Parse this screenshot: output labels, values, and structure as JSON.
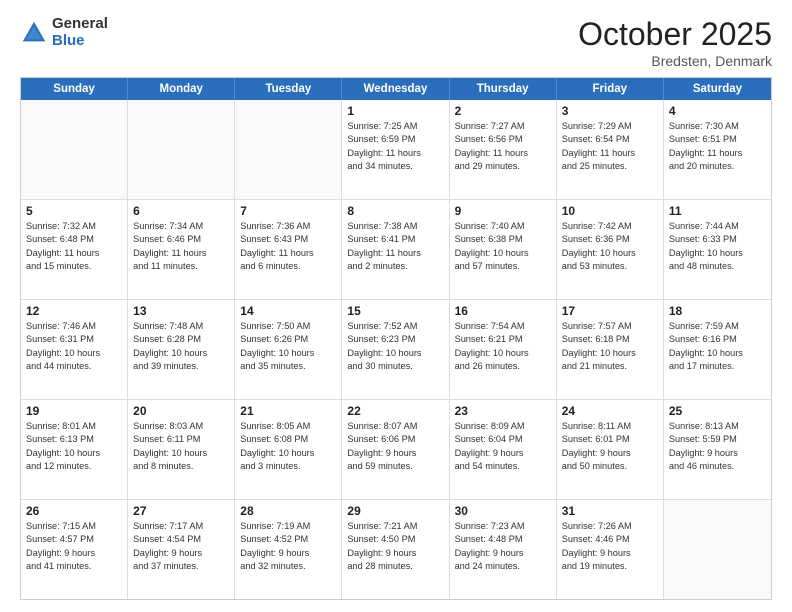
{
  "header": {
    "logo_general": "General",
    "logo_blue": "Blue",
    "month_title": "October 2025",
    "subtitle": "Bredsten, Denmark"
  },
  "days_of_week": [
    "Sunday",
    "Monday",
    "Tuesday",
    "Wednesday",
    "Thursday",
    "Friday",
    "Saturday"
  ],
  "weeks": [
    [
      {
        "day": "",
        "lines": []
      },
      {
        "day": "",
        "lines": []
      },
      {
        "day": "",
        "lines": []
      },
      {
        "day": "1",
        "lines": [
          "Sunrise: 7:25 AM",
          "Sunset: 6:59 PM",
          "Daylight: 11 hours",
          "and 34 minutes."
        ]
      },
      {
        "day": "2",
        "lines": [
          "Sunrise: 7:27 AM",
          "Sunset: 6:56 PM",
          "Daylight: 11 hours",
          "and 29 minutes."
        ]
      },
      {
        "day": "3",
        "lines": [
          "Sunrise: 7:29 AM",
          "Sunset: 6:54 PM",
          "Daylight: 11 hours",
          "and 25 minutes."
        ]
      },
      {
        "day": "4",
        "lines": [
          "Sunrise: 7:30 AM",
          "Sunset: 6:51 PM",
          "Daylight: 11 hours",
          "and 20 minutes."
        ]
      }
    ],
    [
      {
        "day": "5",
        "lines": [
          "Sunrise: 7:32 AM",
          "Sunset: 6:48 PM",
          "Daylight: 11 hours",
          "and 15 minutes."
        ]
      },
      {
        "day": "6",
        "lines": [
          "Sunrise: 7:34 AM",
          "Sunset: 6:46 PM",
          "Daylight: 11 hours",
          "and 11 minutes."
        ]
      },
      {
        "day": "7",
        "lines": [
          "Sunrise: 7:36 AM",
          "Sunset: 6:43 PM",
          "Daylight: 11 hours",
          "and 6 minutes."
        ]
      },
      {
        "day": "8",
        "lines": [
          "Sunrise: 7:38 AM",
          "Sunset: 6:41 PM",
          "Daylight: 11 hours",
          "and 2 minutes."
        ]
      },
      {
        "day": "9",
        "lines": [
          "Sunrise: 7:40 AM",
          "Sunset: 6:38 PM",
          "Daylight: 10 hours",
          "and 57 minutes."
        ]
      },
      {
        "day": "10",
        "lines": [
          "Sunrise: 7:42 AM",
          "Sunset: 6:36 PM",
          "Daylight: 10 hours",
          "and 53 minutes."
        ]
      },
      {
        "day": "11",
        "lines": [
          "Sunrise: 7:44 AM",
          "Sunset: 6:33 PM",
          "Daylight: 10 hours",
          "and 48 minutes."
        ]
      }
    ],
    [
      {
        "day": "12",
        "lines": [
          "Sunrise: 7:46 AM",
          "Sunset: 6:31 PM",
          "Daylight: 10 hours",
          "and 44 minutes."
        ]
      },
      {
        "day": "13",
        "lines": [
          "Sunrise: 7:48 AM",
          "Sunset: 6:28 PM",
          "Daylight: 10 hours",
          "and 39 minutes."
        ]
      },
      {
        "day": "14",
        "lines": [
          "Sunrise: 7:50 AM",
          "Sunset: 6:26 PM",
          "Daylight: 10 hours",
          "and 35 minutes."
        ]
      },
      {
        "day": "15",
        "lines": [
          "Sunrise: 7:52 AM",
          "Sunset: 6:23 PM",
          "Daylight: 10 hours",
          "and 30 minutes."
        ]
      },
      {
        "day": "16",
        "lines": [
          "Sunrise: 7:54 AM",
          "Sunset: 6:21 PM",
          "Daylight: 10 hours",
          "and 26 minutes."
        ]
      },
      {
        "day": "17",
        "lines": [
          "Sunrise: 7:57 AM",
          "Sunset: 6:18 PM",
          "Daylight: 10 hours",
          "and 21 minutes."
        ]
      },
      {
        "day": "18",
        "lines": [
          "Sunrise: 7:59 AM",
          "Sunset: 6:16 PM",
          "Daylight: 10 hours",
          "and 17 minutes."
        ]
      }
    ],
    [
      {
        "day": "19",
        "lines": [
          "Sunrise: 8:01 AM",
          "Sunset: 6:13 PM",
          "Daylight: 10 hours",
          "and 12 minutes."
        ]
      },
      {
        "day": "20",
        "lines": [
          "Sunrise: 8:03 AM",
          "Sunset: 6:11 PM",
          "Daylight: 10 hours",
          "and 8 minutes."
        ]
      },
      {
        "day": "21",
        "lines": [
          "Sunrise: 8:05 AM",
          "Sunset: 6:08 PM",
          "Daylight: 10 hours",
          "and 3 minutes."
        ]
      },
      {
        "day": "22",
        "lines": [
          "Sunrise: 8:07 AM",
          "Sunset: 6:06 PM",
          "Daylight: 9 hours",
          "and 59 minutes."
        ]
      },
      {
        "day": "23",
        "lines": [
          "Sunrise: 8:09 AM",
          "Sunset: 6:04 PM",
          "Daylight: 9 hours",
          "and 54 minutes."
        ]
      },
      {
        "day": "24",
        "lines": [
          "Sunrise: 8:11 AM",
          "Sunset: 6:01 PM",
          "Daylight: 9 hours",
          "and 50 minutes."
        ]
      },
      {
        "day": "25",
        "lines": [
          "Sunrise: 8:13 AM",
          "Sunset: 5:59 PM",
          "Daylight: 9 hours",
          "and 46 minutes."
        ]
      }
    ],
    [
      {
        "day": "26",
        "lines": [
          "Sunrise: 7:15 AM",
          "Sunset: 4:57 PM",
          "Daylight: 9 hours",
          "and 41 minutes."
        ]
      },
      {
        "day": "27",
        "lines": [
          "Sunrise: 7:17 AM",
          "Sunset: 4:54 PM",
          "Daylight: 9 hours",
          "and 37 minutes."
        ]
      },
      {
        "day": "28",
        "lines": [
          "Sunrise: 7:19 AM",
          "Sunset: 4:52 PM",
          "Daylight: 9 hours",
          "and 32 minutes."
        ]
      },
      {
        "day": "29",
        "lines": [
          "Sunrise: 7:21 AM",
          "Sunset: 4:50 PM",
          "Daylight: 9 hours",
          "and 28 minutes."
        ]
      },
      {
        "day": "30",
        "lines": [
          "Sunrise: 7:23 AM",
          "Sunset: 4:48 PM",
          "Daylight: 9 hours",
          "and 24 minutes."
        ]
      },
      {
        "day": "31",
        "lines": [
          "Sunrise: 7:26 AM",
          "Sunset: 4:46 PM",
          "Daylight: 9 hours",
          "and 19 minutes."
        ]
      },
      {
        "day": "",
        "lines": []
      }
    ]
  ]
}
